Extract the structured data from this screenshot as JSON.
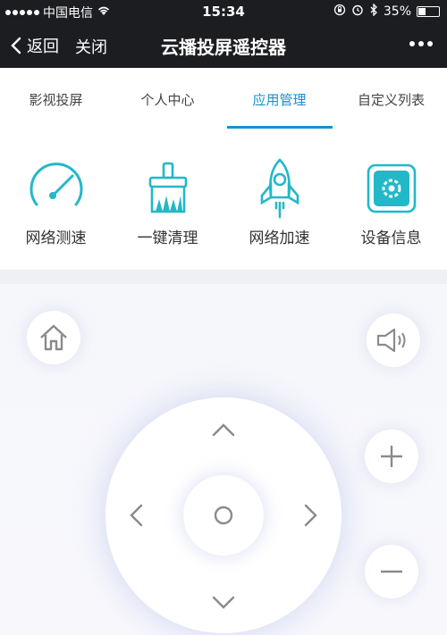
{
  "status_bar": {
    "carrier": "中国电信",
    "time": "15:34",
    "battery": "35%",
    "battery_level": 0.35,
    "signal_bars": 5,
    "icons": [
      "wifi-icon",
      "orientation-lock-icon",
      "alarm-icon",
      "bluetooth-icon",
      "battery-icon"
    ]
  },
  "nav": {
    "back_label": "返回",
    "close_label": "关闭",
    "title": "云播投屏遥控器",
    "more_icon": "more-dots-icon"
  },
  "tabs": [
    {
      "label": "影视投屏",
      "active": false
    },
    {
      "label": "个人中心",
      "active": false
    },
    {
      "label": "应用管理",
      "active": true
    },
    {
      "label": "自定义列表",
      "active": false
    }
  ],
  "tools": [
    {
      "label": "网络测速",
      "icon": "speedometer-icon"
    },
    {
      "label": "一键清理",
      "icon": "broom-icon"
    },
    {
      "label": "网络加速",
      "icon": "rocket-icon"
    },
    {
      "label": "设备信息",
      "icon": "device-gear-icon"
    }
  ],
  "remote": {
    "icons": [
      "home-icon",
      "speaker-icon",
      "plus-icon",
      "minus-icon",
      "arrow-up-icon",
      "arrow-down-icon",
      "arrow-left-icon",
      "arrow-right-icon",
      "ok-circle-icon"
    ]
  },
  "colors": {
    "accent": "#1a8fcf",
    "icon_teal": "#22b8c8",
    "header_bg": "#1c1d21",
    "remote_icon": "#8a8a8a"
  }
}
